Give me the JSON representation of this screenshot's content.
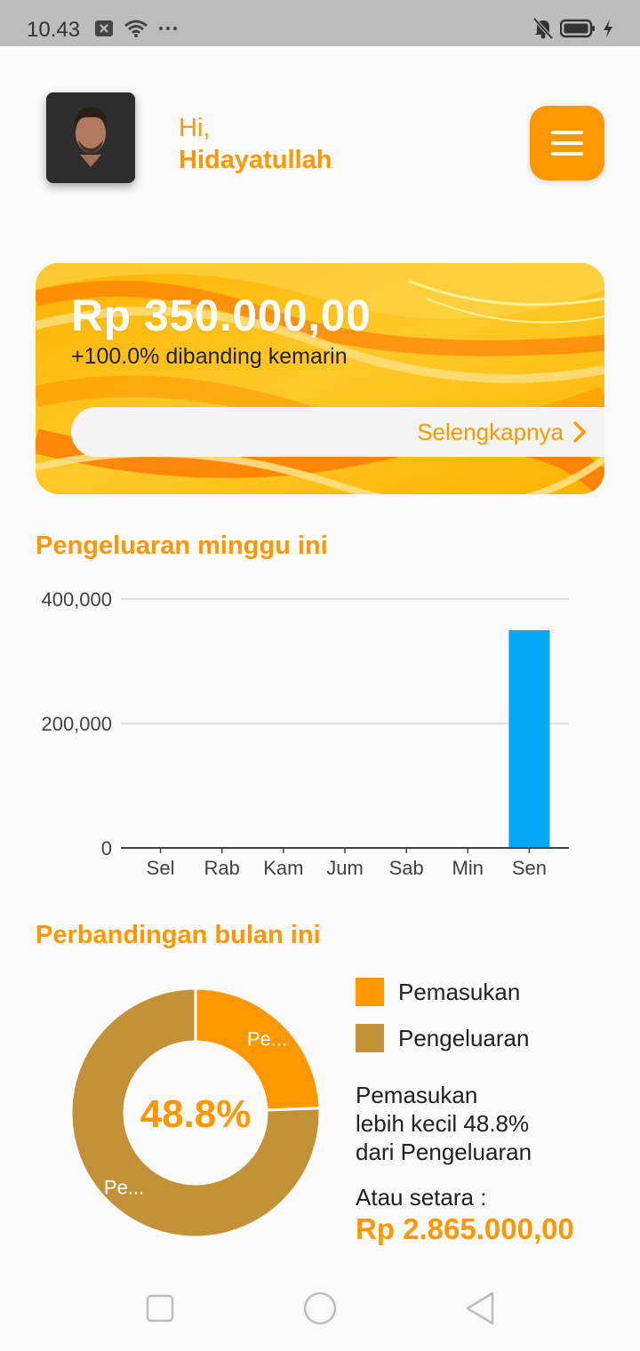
{
  "status_bar": {
    "time": "10.43",
    "icons": [
      "close-box-icon",
      "wifi-icon",
      "more-dots-icon",
      "mute-icon",
      "battery-icon",
      "charging-icon"
    ]
  },
  "header": {
    "greeting": "Hi,",
    "user_name": "Hidayatullah",
    "menu_icon": "hamburger-menu-icon"
  },
  "balance_card": {
    "amount": "Rp 350.000,00",
    "change_text": "+100.0% dibanding kemarin",
    "more_label": "Selengkapnya"
  },
  "weekly": {
    "title": "Pengeluaran minggu ini"
  },
  "chart_data": {
    "type": "bar",
    "categories": [
      "Sel",
      "Rab",
      "Kam",
      "Jum",
      "Sab",
      "Min",
      "Sen"
    ],
    "values": [
      0,
      0,
      0,
      0,
      0,
      0,
      350000
    ],
    "ylim": [
      0,
      400000
    ],
    "yticks": [
      0,
      200000,
      400000
    ],
    "ytick_labels": [
      "0",
      "200,000",
      "400,000"
    ],
    "bar_color": "#03a9f4",
    "grid": true
  },
  "monthly": {
    "title": "Perbandingan bulan ini",
    "center_label": "48.8%",
    "pie": {
      "type": "pie",
      "slices": [
        {
          "name": "Pemasukan",
          "percent": 24.4,
          "label": "Pe...",
          "color": "#ff9800"
        },
        {
          "name": "Pengeluaran",
          "percent": 75.6,
          "label": "Pe...",
          "color": "#c49236"
        }
      ]
    },
    "legend": [
      {
        "label": "Pemasukan",
        "color": "#ff9800"
      },
      {
        "label": "Pengeluaran",
        "color": "#c49236"
      }
    ],
    "compare_lines": [
      "Pemasukan",
      "lebih kecil 48.8%",
      "dari Pengeluaran"
    ],
    "equal_label": "Atau setara :",
    "equal_value": "Rp 2.865.000,00"
  },
  "nav": {
    "icons": [
      "recent-apps-icon",
      "home-icon",
      "back-icon"
    ]
  },
  "colors": {
    "accent": "#ff9800",
    "bar": "#03a9f4",
    "expense": "#c49236"
  }
}
